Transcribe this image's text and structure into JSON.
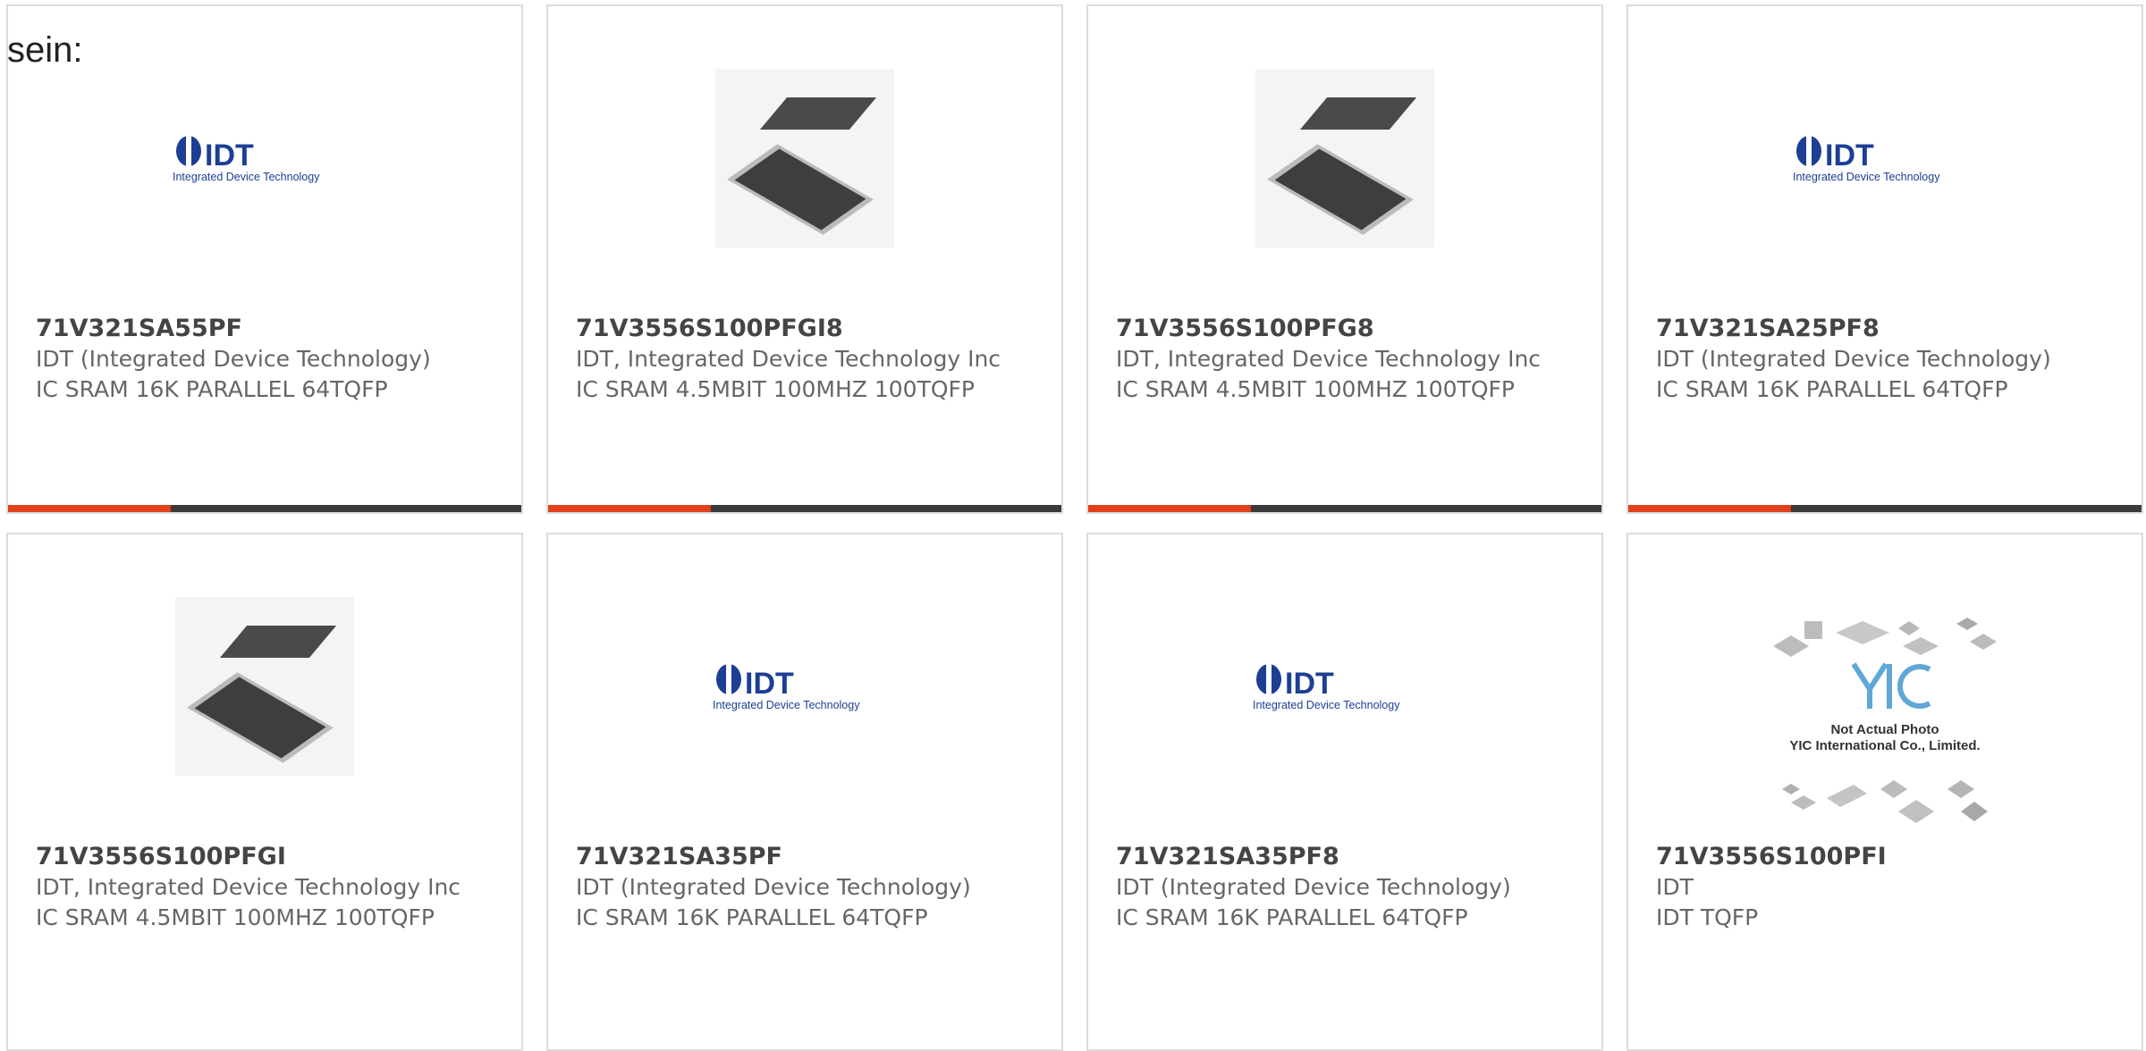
{
  "intro": "sein:",
  "logo": {
    "text": "IDT",
    "tagline": "Integrated Device Technology"
  },
  "yic": {
    "line1": "Not Actual Photo",
    "line2": "YIC International Co., Limited."
  },
  "colors": {
    "accent": "#e0401a",
    "bar": "#3b3b3b"
  },
  "cards": [
    {
      "part": "71V321SA55PF",
      "mfr": "IDT (Integrated Device Technology)",
      "desc": "IC SRAM 16K PARALLEL 64TQFP",
      "image": "idt-logo"
    },
    {
      "part": "71V3556S100PFGI8",
      "mfr": "IDT, Integrated Device Technology Inc",
      "desc": "IC SRAM 4.5MBIT 100MHZ 100TQFP",
      "image": "chip-photo"
    },
    {
      "part": "71V3556S100PFG8",
      "mfr": "IDT, Integrated Device Technology Inc",
      "desc": "IC SRAM 4.5MBIT 100MHZ 100TQFP",
      "image": "chip-photo"
    },
    {
      "part": "71V321SA25PF8",
      "mfr": "IDT (Integrated Device Technology)",
      "desc": "IC SRAM 16K PARALLEL 64TQFP",
      "image": "idt-logo"
    },
    {
      "part": "71V3556S100PFGI",
      "mfr": "IDT, Integrated Device Technology Inc",
      "desc": "IC SRAM 4.5MBIT 100MHZ 100TQFP",
      "image": "chip-photo"
    },
    {
      "part": "71V321SA35PF",
      "mfr": "IDT (Integrated Device Technology)",
      "desc": "IC SRAM 16K PARALLEL 64TQFP",
      "image": "idt-logo"
    },
    {
      "part": "71V321SA35PF8",
      "mfr": "IDT (Integrated Device Technology)",
      "desc": "IC SRAM 16K PARALLEL 64TQFP",
      "image": "idt-logo"
    },
    {
      "part": "71V3556S100PFI",
      "mfr": "IDT",
      "desc": "IDT TQFP",
      "image": "yic-placeholder"
    }
  ]
}
